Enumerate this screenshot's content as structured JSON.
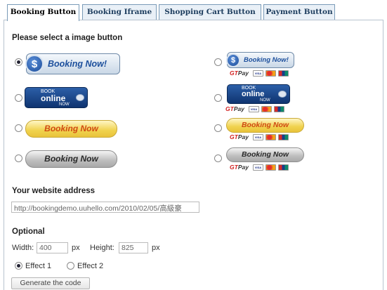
{
  "tabs": [
    {
      "label": "Booking Button",
      "active": true
    },
    {
      "label": "Booking Iframe",
      "active": false
    },
    {
      "label": "Shopping Cart Button",
      "active": false
    },
    {
      "label": "Payment Button",
      "active": false
    }
  ],
  "select_heading": "Please select a image button",
  "buttons": {
    "dollar_text": "Booking Now!",
    "dollar_symbol": "$",
    "online_line1": "BOOK",
    "online_line2": "online",
    "online_line3": "NOW",
    "gold_text": "Booking Now",
    "grey_text": "Booking Now",
    "selected": "left-1"
  },
  "payment_strip": {
    "gt": "GT",
    "pay": "Pay",
    "cards": [
      "VISA",
      "MC",
      "UnionPay"
    ]
  },
  "address": {
    "heading": "Your website address",
    "value": "http://bookingdemo.uuhello.com/2010/02/05/高級豪"
  },
  "optional": {
    "heading": "Optional",
    "width_label": "Width:",
    "width_value": "400",
    "width_unit": "px",
    "height_label": "Height:",
    "height_value": "825",
    "height_unit": "px",
    "effects": [
      {
        "label": "Effect 1",
        "checked": true
      },
      {
        "label": "Effect 2",
        "checked": false
      }
    ],
    "generate_label": "Generate the code"
  }
}
